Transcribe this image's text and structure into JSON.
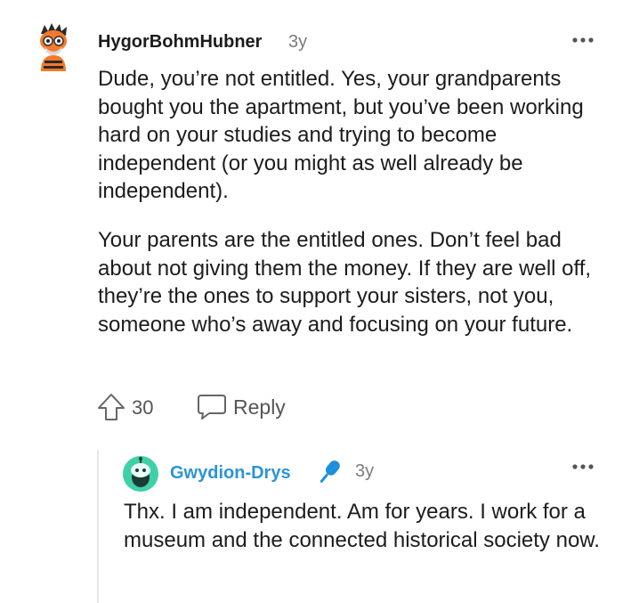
{
  "comment": {
    "username": "HygorBohmHubner",
    "age": "3y",
    "paragraphs": [
      "Dude, you’re not entitled. Yes, your grandparents bought you the apartment, but you’ve been working hard on your studies and trying to become independent (or you might as well already be independent).",
      "Your parents are the entitled ones. Don’t feel bad about not giving them the money. If they are well off, they’re the ones to support your sisters, not you, someone who’s away and focusing on your future."
    ],
    "votes": "30",
    "reply_label": "Reply",
    "more_icon": "more-horizontal-icon",
    "upvote_icon": "upvote-arrow-icon",
    "reply_icon": "chat-bubble-icon"
  },
  "reply": {
    "username": "Gwydion-Drys",
    "age": "3y",
    "flair_icon": "microphone-icon",
    "text": "Thx. I am independent. Am for years. I work for a museum and the connected historical society now.",
    "more_icon": "more-horizontal-icon"
  },
  "colors": {
    "reply_username": "#2b95d6",
    "avatar2_bg": "#3fd0a8",
    "mic": "#1e8fdb"
  }
}
